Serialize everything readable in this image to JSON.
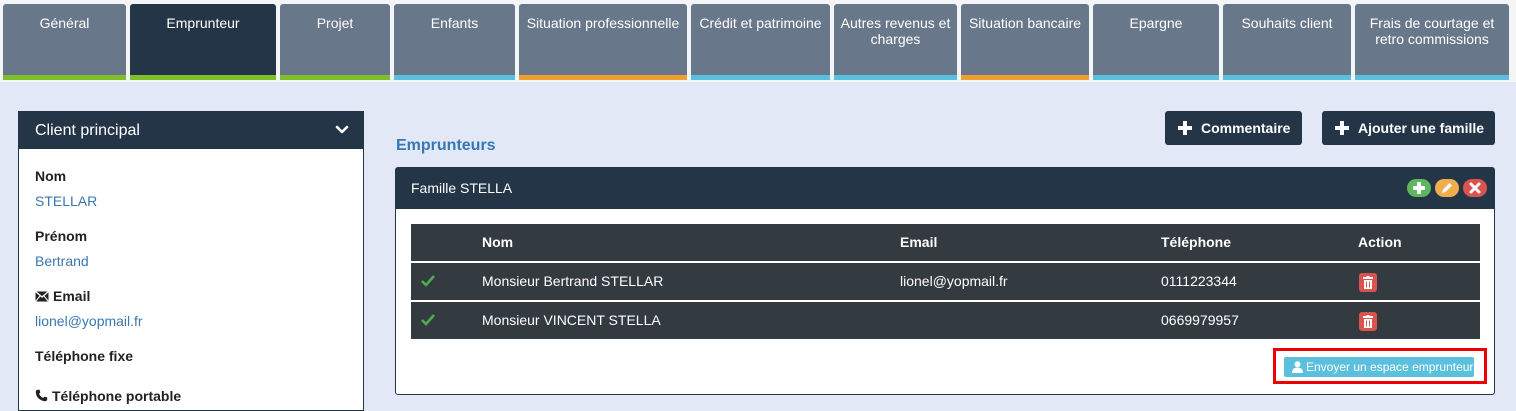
{
  "tabs": [
    {
      "label": "Général"
    },
    {
      "label": "Emprunteur"
    },
    {
      "label": "Projet"
    },
    {
      "label": "Enfants"
    },
    {
      "label": "Situation professionnelle"
    },
    {
      "label": "Crédit et patrimoine"
    },
    {
      "label": "Autres revenus et charges"
    },
    {
      "label": "Situation bancaire"
    },
    {
      "label": "Epargne"
    },
    {
      "label": "Souhaits client"
    },
    {
      "label": "Frais de courtage et retro commissions"
    }
  ],
  "active_tab": "Emprunteur",
  "client_panel": {
    "title": "Client principal",
    "fields": {
      "nom_label": "Nom",
      "nom_value": "STELLAR",
      "prenom_label": "Prénom",
      "prenom_value": "Bertrand",
      "email_label": "Email",
      "email_value": "lionel@yopmail.fr",
      "tel_fixe_label": "Téléphone fixe",
      "tel_portable_label": "Téléphone portable"
    }
  },
  "main": {
    "section_title": "Emprunteurs",
    "buttons": {
      "commentaire": "Commentaire",
      "ajouter_famille": "Ajouter une famille"
    },
    "family": {
      "title": "Famille STELLA",
      "table": {
        "headers": {
          "nom": "Nom",
          "email": "Email",
          "telephone": "Téléphone",
          "action": "Action"
        },
        "rows": [
          {
            "nom": "Monsieur Bertrand STELLAR",
            "email": "lionel@yopmail.fr",
            "telephone": "0111223344"
          },
          {
            "nom": "Monsieur VINCENT STELLA",
            "email": "",
            "telephone": "0669979957"
          }
        ]
      },
      "send_button": "Envoyer un espace emprunteur"
    }
  },
  "colors": {
    "tab_bg": "#687789",
    "tab_active": "#253548",
    "accent_blue": "#5bc0de",
    "accent_green": "#80bf2c",
    "accent_orange": "#f0a030",
    "danger": "#d9534f",
    "highlight_box": "#ee0000"
  },
  "icons": [
    "chevron-down-icon",
    "envelope-icon",
    "phone-icon",
    "plus-icon",
    "check-icon",
    "trash-icon",
    "pencil-icon",
    "close-icon",
    "user-icon"
  ]
}
